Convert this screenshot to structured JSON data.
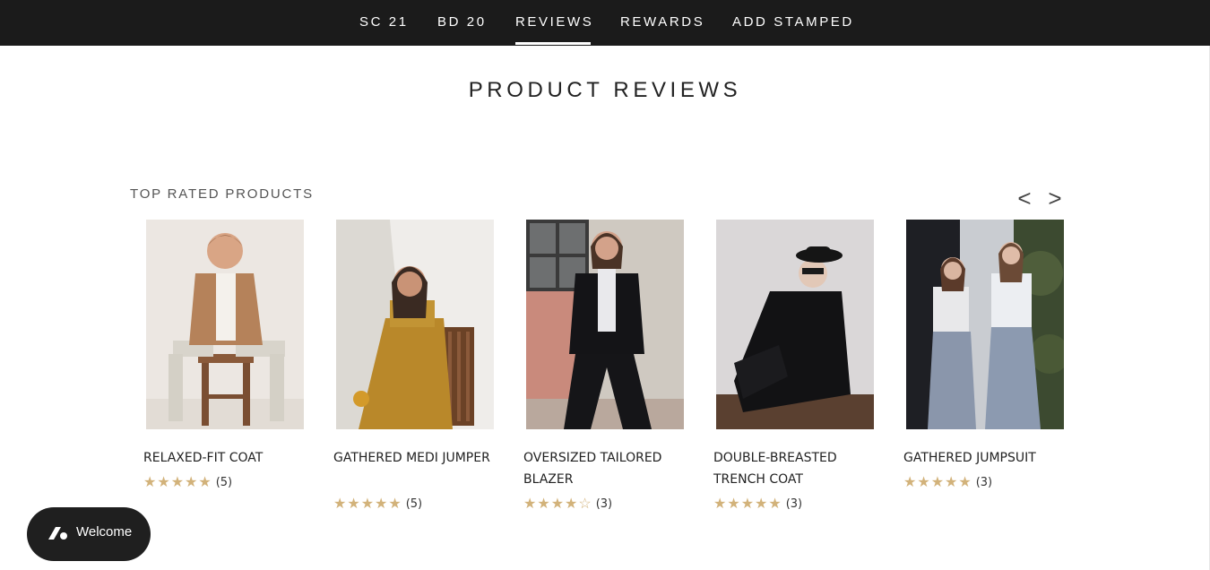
{
  "nav": {
    "items": [
      {
        "label": "SC 21"
      },
      {
        "label": "BD 20"
      },
      {
        "label": "REVIEWS"
      },
      {
        "label": "REWARDS"
      },
      {
        "label": "ADD STAMPED"
      }
    ],
    "active": "REVIEWS"
  },
  "page": {
    "title": "PRODUCT REVIEWS"
  },
  "section": {
    "title": "TOP RATED PRODUCTS",
    "prev_label": "<",
    "next_label": ">"
  },
  "products": [
    {
      "name": "RELAXED-FIT COAT",
      "stars": "★★★★★",
      "rating": 5,
      "count": "(5)"
    },
    {
      "name": "GATHERED MEDI JUMPER",
      "stars": "★★★★★",
      "rating": 5,
      "count": "(5)"
    },
    {
      "name": "OVERSIZED TAILORED BLAZER",
      "stars": "★★★★☆",
      "rating": 4,
      "count": "(3)"
    },
    {
      "name": "DOUBLE-BREASTED TRENCH COAT",
      "stars": "★★★★★",
      "rating": 5,
      "count": "(3)"
    },
    {
      "name": "GATHERED JUMPSUIT",
      "stars": "★★★★★",
      "rating": 5,
      "count": "(3)"
    }
  ],
  "widget": {
    "label": "Welcome",
    "icon": "rewards-logo-icon"
  },
  "colors": {
    "nav_bg": "#1b1b1b",
    "star": "#d2b27a",
    "widget_bg": "#1f1f1f"
  }
}
